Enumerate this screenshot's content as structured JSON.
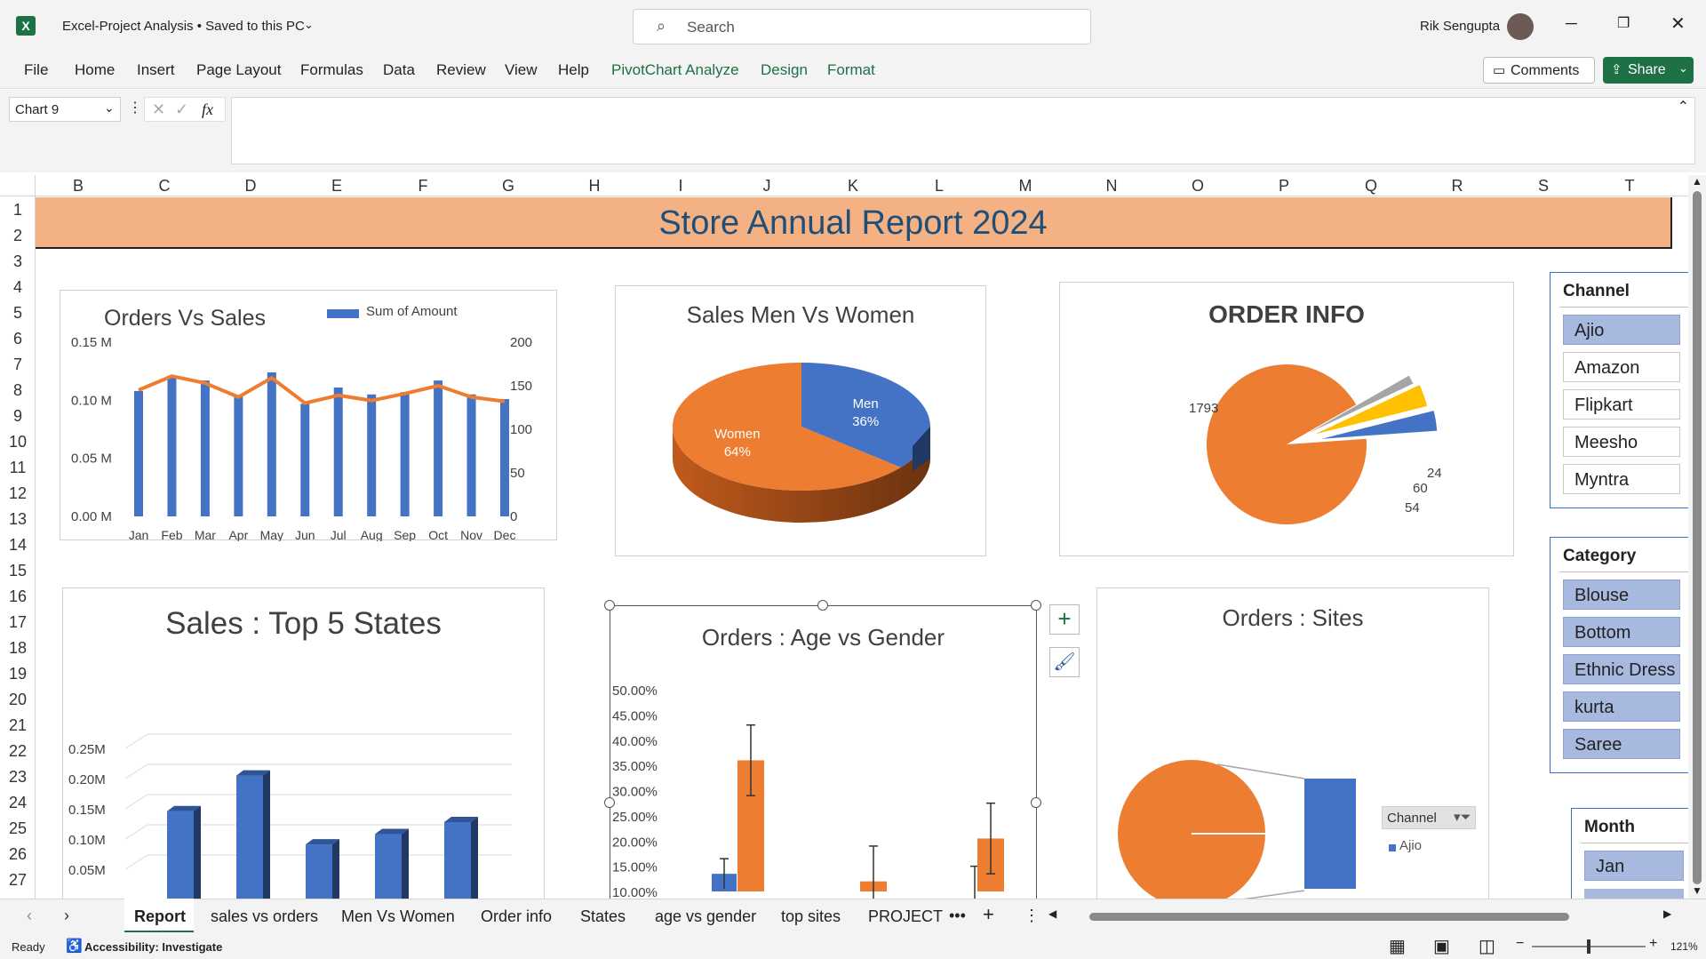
{
  "titlebar": {
    "app_title": "Excel-Project Analysis • Saved to this PC",
    "search_placeholder": "Search",
    "user_name": "Rik Sengupta"
  },
  "ribbon": {
    "tabs": [
      "File",
      "Home",
      "Insert",
      "Page Layout",
      "Formulas",
      "Data",
      "Review",
      "View",
      "Help",
      "PivotChart Analyze",
      "Design",
      "Format"
    ],
    "comments_label": "Comments",
    "share_label": "Share"
  },
  "formula_bar": {
    "name_box": "Chart 9",
    "fx": "fx",
    "formula": ""
  },
  "columns": [
    "B",
    "C",
    "D",
    "E",
    "F",
    "G",
    "H",
    "I",
    "J",
    "K",
    "L",
    "M",
    "N",
    "O",
    "P",
    "Q",
    "R",
    "S",
    "T"
  ],
  "rows": [
    "1",
    "2",
    "3",
    "4",
    "5",
    "6",
    "7",
    "8",
    "9",
    "10",
    "11",
    "12",
    "13",
    "14",
    "15",
    "16",
    "17",
    "18",
    "19",
    "20",
    "21",
    "22",
    "23",
    "24",
    "25",
    "26",
    "27"
  ],
  "banner": {
    "title": "Store Annual Report 2024",
    "color": "#f4b183"
  },
  "charts": {
    "orders_vs_sales": {
      "title": "Orders Vs Sales",
      "legend": "Sum of Amount"
    },
    "men_vs_women": {
      "title": "Sales Men Vs Women"
    },
    "order_info": {
      "title": "ORDER INFO"
    },
    "top5_states": {
      "title": "Sales : Top 5  States"
    },
    "age_gender": {
      "title": "Orders : Age vs Gender"
    },
    "sites": {
      "title": "Orders : Sites",
      "filter_label": "Channel",
      "legend_item": "Ajio"
    }
  },
  "chart_data": [
    {
      "type": "bar",
      "title": "Orders Vs Sales",
      "categories": [
        "Jan",
        "Feb",
        "Mar",
        "Apr",
        "May",
        "Jun",
        "Jul",
        "Aug",
        "Sep",
        "Oct",
        "Nov",
        "Dec"
      ],
      "series": [
        {
          "name": "Sum of Amount",
          "values": [
            0.108,
            0.121,
            0.117,
            0.104,
            0.124,
            0.097,
            0.111,
            0.105,
            0.107,
            0.117,
            0.105,
            0.101
          ]
        },
        {
          "values": [
            145,
            161,
            153,
            137,
            159,
            130,
            139,
            133,
            141,
            150,
            137,
            132
          ]
        }
      ],
      "y_ticks": [
        "0.00 M",
        "0.05 M",
        "0.10 M",
        "0.15 M"
      ],
      "y2_ticks": [
        "0",
        "50",
        "100",
        "150",
        "200"
      ]
    },
    {
      "type": "pie",
      "title": "Sales Men Vs Women",
      "labels": [
        "Men",
        "Women"
      ],
      "values": [
        36,
        64
      ],
      "value_labels": [
        "36%",
        "64%"
      ]
    },
    {
      "type": "pie",
      "title": "ORDER INFO",
      "values": [
        1793,
        24,
        60,
        54
      ],
      "value_labels": [
        "1793",
        "24",
        "60",
        "54"
      ]
    },
    {
      "type": "bar",
      "title": "Sales : Top 5  States",
      "values": [
        0.146,
        0.205,
        0.091,
        0.108,
        0.128
      ],
      "y_ticks": [
        "0.05M",
        "0.10M",
        "0.15M",
        "0.20M",
        "0.25M"
      ]
    },
    {
      "type": "bar",
      "title": "Orders : Age vs Gender",
      "y_ticks": [
        "10.00%",
        "15.00%",
        "20.00%",
        "25.00%",
        "30.00%",
        "35.00%",
        "40.00%",
        "45.00%",
        "50.00%"
      ],
      "series": [
        {
          "values": [
            13.5,
            0,
            9
          ]
        },
        {
          "values": [
            36,
            12,
            20.5
          ]
        }
      ]
    },
    {
      "type": "pie",
      "title": "Orders : Sites",
      "labels": [
        "Ajio"
      ],
      "values": [
        100
      ]
    }
  ],
  "slicers": {
    "channel": {
      "header": "Channel",
      "items": [
        "Ajio",
        "Amazon",
        "Flipkart",
        "Meesho",
        "Myntra"
      ]
    },
    "category": {
      "header": "Category",
      "items": [
        "Blouse",
        "Bottom",
        "Ethnic Dress",
        "kurta",
        "Saree"
      ]
    },
    "month": {
      "header": "Month",
      "items": [
        "Jan"
      ]
    }
  },
  "sheet_tabs": [
    "Report",
    "sales vs orders",
    "Men Vs Women",
    "Order info",
    "States",
    "age vs gender",
    "top sites",
    "PROJECT"
  ],
  "status": {
    "ready": "Ready",
    "accessibility": "Accessibility: Investigate",
    "zoom": "121%"
  }
}
